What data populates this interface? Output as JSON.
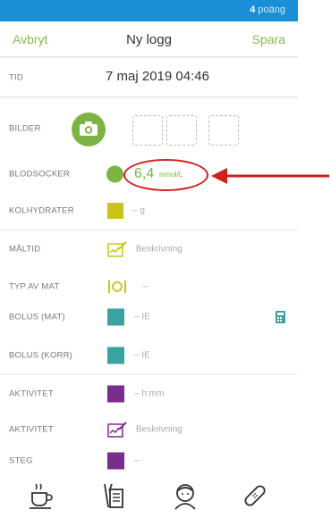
{
  "status": {
    "points_value": "4",
    "points_label": "poäng"
  },
  "navbar": {
    "cancel_label": "Avbryt",
    "title": "Ny logg",
    "save_label": "Spara"
  },
  "rows": {
    "time": {
      "label": "TID",
      "value": "7 maj 2019 04:46"
    },
    "images": {
      "label": "BILDER"
    },
    "blood_sugar": {
      "label": "BLODSOCKER",
      "value": "6,4",
      "unit": "mmol/L"
    },
    "carbs": {
      "label": "KOLHYDRATER",
      "value": "– g"
    },
    "meal": {
      "label": "MÅLTID",
      "value": "Beskrivning"
    },
    "food_type": {
      "label": "TYP AV MAT",
      "value": "–"
    },
    "bolus_meal": {
      "label": "BOLUS (MAT)",
      "value": "– IE"
    },
    "bolus_corr": {
      "label": "BOLUS (KORR)",
      "value": "– IE"
    },
    "activity_time": {
      "label": "AKTIVITET",
      "value": "– h:mm"
    },
    "activity_desc": {
      "label": "AKTIVITET",
      "value": "Beskrivning"
    },
    "steps": {
      "label": "STEG",
      "value": "–"
    }
  },
  "colors": {
    "status_bar": "#1a8fd8",
    "accent_green": "#7cb342",
    "carbs_yellow": "#c8c418",
    "bolus_teal": "#3aa3a0",
    "activity_purple": "#7b2d8e",
    "annotation_red": "#d0201b"
  },
  "icons": {
    "camera": "camera-icon",
    "meal": "notepad-icon",
    "food_type": "cutlery-icon",
    "calculator": "calculator-icon",
    "tabs": [
      "coffee-icon",
      "food-menu-icon",
      "person-icon",
      "bandage-icon"
    ]
  }
}
